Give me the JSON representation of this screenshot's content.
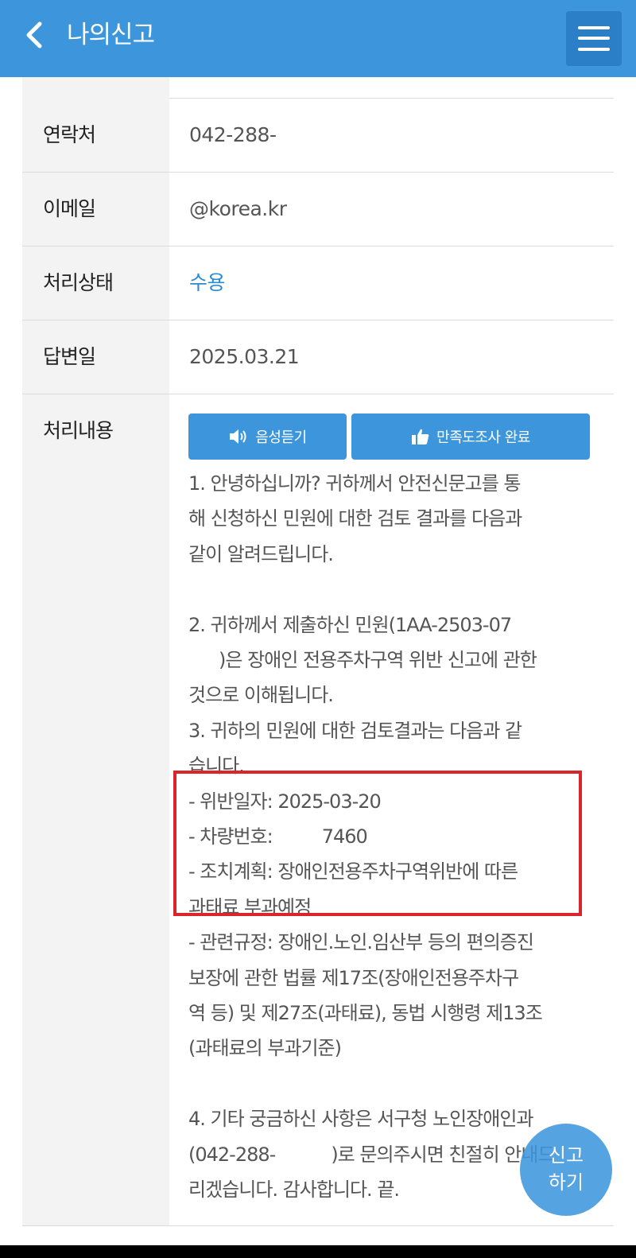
{
  "header": {
    "title": "나의신고"
  },
  "rows": {
    "contact": {
      "label": "연락처",
      "value": "042-288-"
    },
    "email": {
      "label": "이메일",
      "value": "@korea.kr"
    },
    "status": {
      "label": "처리상태",
      "value": "수용"
    },
    "answer_date": {
      "label": "답변일",
      "value": "2025.03.21"
    },
    "content": {
      "label": "처리내용"
    }
  },
  "buttons": {
    "voice": "음성듣기",
    "survey": "만족도조사 완료"
  },
  "answer": {
    "p1_l1": "1. 안녕하십니까? 귀하께서 안전신문고를 통",
    "p1_l2": "해 신청하신 민원에 대한 검토 결과를 다음과",
    "p1_l3": "같이 알려드립니다.",
    "p2_l1": "2. 귀하께서 제출하신 민원(1AA-2503-07",
    "p2_l2": ")은 장애인 전용주차구역 위반 신고에 관한",
    "p2_l3": "것으로 이해됩니다.",
    "p3_l1": "3. 귀하의 민원에 대한 검토결과는 다음과 같",
    "p3_l2": "습니다.",
    "violation_date": "- 위반일자: 2025-03-20",
    "car_number_label": "- 차량번호:",
    "car_number": "7460",
    "action_l1": "- 조치계획: 장애인전용주차구역위반에 따른",
    "action_l2": "과태료 부과예정",
    "rule_l1": "- 관련규정: 장애인.노인.임산부 등의 편의증진",
    "rule_l2": "보장에 관한 법률 제17조(장애인전용주차구",
    "rule_l3": "역 등) 및 제27조(과태료), 동법 시행령 제13조",
    "rule_l4": "(과태료의 부과기준)",
    "p4_l1": "4. 기타 궁금하신 사항은 서구청 노인장애인과",
    "p4_l2a": "(042-288-",
    "p4_l2b": ")로 문의주시면 친절히 안내드",
    "p4_l3": "리겠습니다. 감사합니다. 끝."
  },
  "fab": {
    "line1": "신고",
    "line2": "하기"
  },
  "colors": {
    "header_bg": "#3d96dc",
    "status_text": "#2a8bd4",
    "highlight_border": "#d9252b"
  },
  "icons": {
    "back": "chevron-left-icon",
    "menu": "hamburger-menu-icon",
    "voice": "speaker-icon",
    "survey": "thumbs-up-icon"
  }
}
